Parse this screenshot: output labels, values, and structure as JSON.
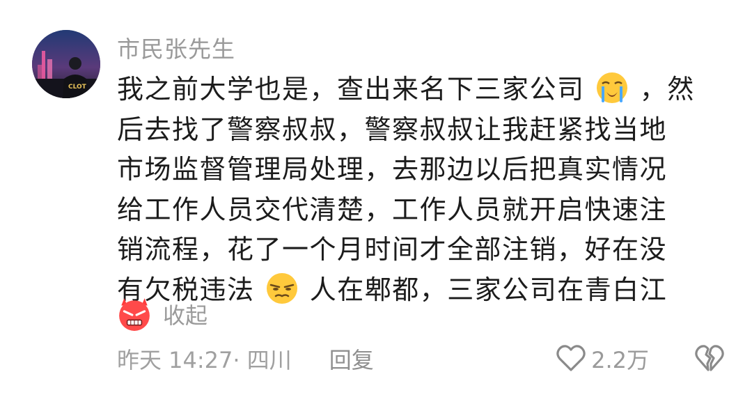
{
  "comment": {
    "username": "市民张先生",
    "avatar_icon": "user-avatar-night-city",
    "avatar_badge_text": "CLOT",
    "lines": [
      {
        "text_before": "我之前大学也是，查出来名下三家公司",
        "emoji": "loudly-crying-face-emoji",
        "text_after": "，然"
      },
      {
        "text": "后去找了警察叔叔，警察叔叔让我赶紧找当地"
      },
      {
        "text": "市场监督管理局处理，去那边以后把真实情况"
      },
      {
        "text": "给工作人员交代清楚，工作人员就开启快速注"
      },
      {
        "text": "销流程，花了一个月时间才全部注销，好在没"
      },
      {
        "text_before": "有欠税违法",
        "emoji": "unamused-face-emoji",
        "text_after": "人在郫都，三家公司在青白江"
      }
    ],
    "trailing_emoji": "angry-face-emoji",
    "collapse_label": "收起",
    "timestamp": "昨天 14:27· 四川",
    "reply_label": "回复",
    "like_icon": "heart-outline-icon",
    "like_count": "2.2万",
    "dislike_icon": "broken-heart-icon"
  },
  "colors": {
    "background": "#ffffff",
    "text_primary": "#1c1c1c",
    "text_secondary": "#9a9a9a",
    "emoji_yellow": "#ffc93c",
    "emoji_red": "#ff3b3b"
  }
}
